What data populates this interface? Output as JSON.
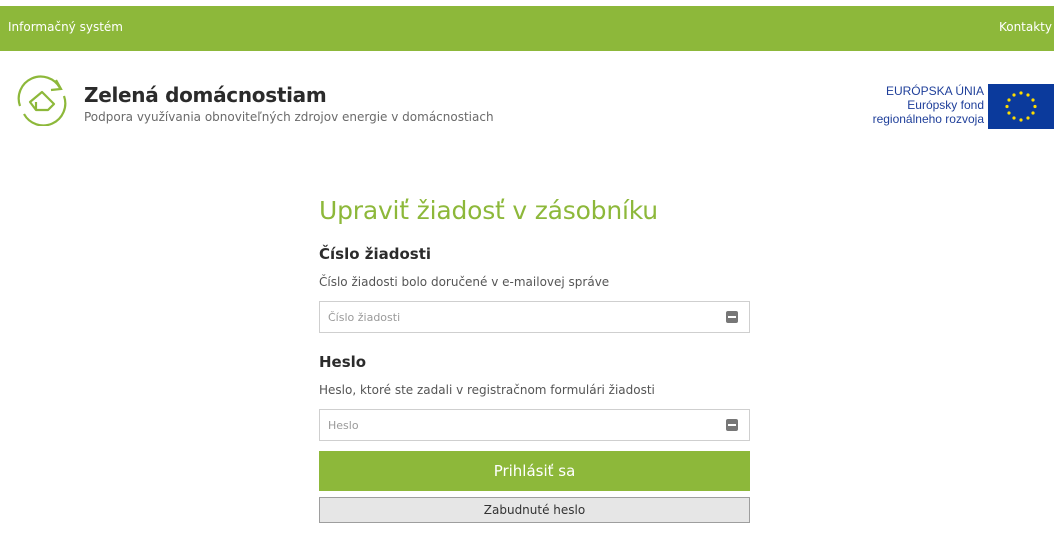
{
  "topbar": {
    "left_label": "Informačný systém",
    "right_label": "Kontakty"
  },
  "brand": {
    "title": "Zelená domácnostiam",
    "subtitle": "Podpora využívania obnoviteľných zdrojov energie v domácnostiach",
    "logo_icon": "house-refresh-icon"
  },
  "eu": {
    "line1": "EURÓPSKA ÚNIA",
    "line2": "Európsky fond",
    "line3": "regionálneho rozvoja",
    "flag_icon": "eu-flag-icon"
  },
  "form": {
    "title": "Upraviť žiadosť v zásobníku",
    "request_number": {
      "title": "Číslo žiadosti",
      "help": "Číslo žiadosti bolo doručené v e-mailovej správe",
      "placeholder": "Číslo žiadosti",
      "value": ""
    },
    "password": {
      "title": "Heslo",
      "help": "Heslo, ktoré ste zadali v registračnom formulári žiadosti",
      "placeholder": "Heslo",
      "value": ""
    },
    "submit_label": "Prihlásiť sa",
    "forgot_label": "Zabudnuté heslo"
  },
  "colors": {
    "brand_green": "#8db83a",
    "eu_blue": "#0b3a9c",
    "eu_star": "#ffdd00",
    "eu_text": "#1f3f9a"
  }
}
